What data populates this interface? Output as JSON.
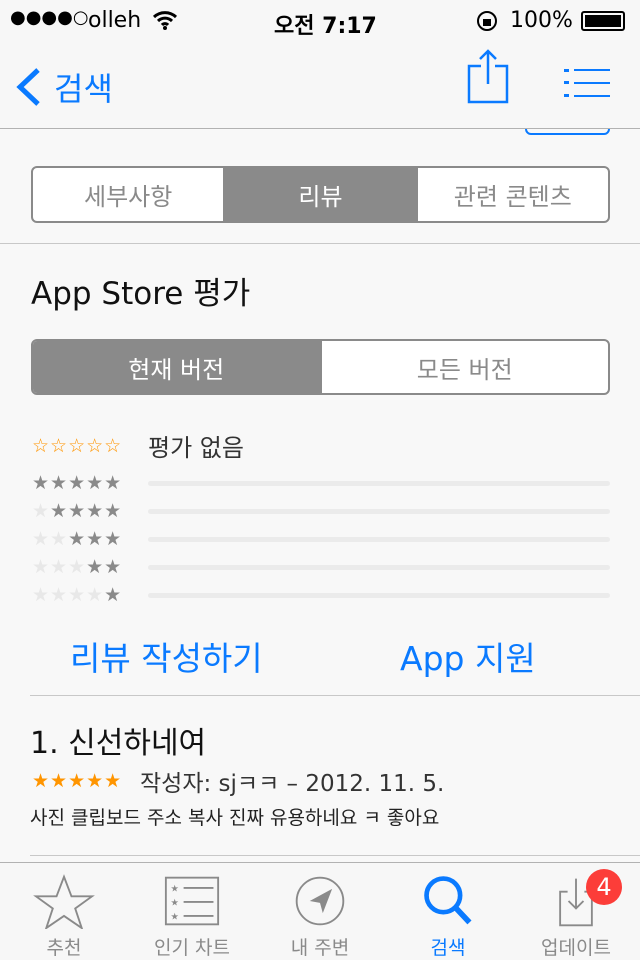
{
  "status": {
    "carrier": "olleh",
    "signal": "●●●●○",
    "time": "오전 7:17",
    "battery": "100%"
  },
  "nav": {
    "back_label": "검색",
    "partial_text": "평가 없음"
  },
  "detail_tabs": [
    {
      "label": "세부사항"
    },
    {
      "label": "리뷰",
      "selected": true
    },
    {
      "label": "관련 콘텐츠"
    }
  ],
  "ratings": {
    "title": "App Store 평가",
    "version_tabs": [
      {
        "label": "현재 버전",
        "selected": true
      },
      {
        "label": "모든 버전"
      }
    ],
    "summary_stars": "☆☆☆☆☆",
    "summary_text": "평가 없음",
    "histogram": [
      {
        "stars": 5,
        "fraction": 0
      },
      {
        "stars": 4,
        "fraction": 0
      },
      {
        "stars": 3,
        "fraction": 0
      },
      {
        "stars": 2,
        "fraction": 0
      },
      {
        "stars": 1,
        "fraction": 0
      }
    ]
  },
  "actions": {
    "write_review": "리뷰 작성하기",
    "app_support": "App 지원"
  },
  "review": {
    "title": "1. 신선하네여",
    "stars": "★★★★★",
    "meta": "작성자: sjㅋㅋ – 2012. 11. 5.",
    "body": "사진 클립보드 주소 복사 진짜 유용하네요 ㅋ 좋아요"
  },
  "tabbar": [
    {
      "label": "추천"
    },
    {
      "label": "인기 차트"
    },
    {
      "label": "내 주변"
    },
    {
      "label": "검색",
      "selected": true
    },
    {
      "label": "업데이트",
      "badge": "4"
    }
  ],
  "colors": {
    "accent": "#0a7aff",
    "star": "#ff9500",
    "badge": "#fc3d39"
  }
}
